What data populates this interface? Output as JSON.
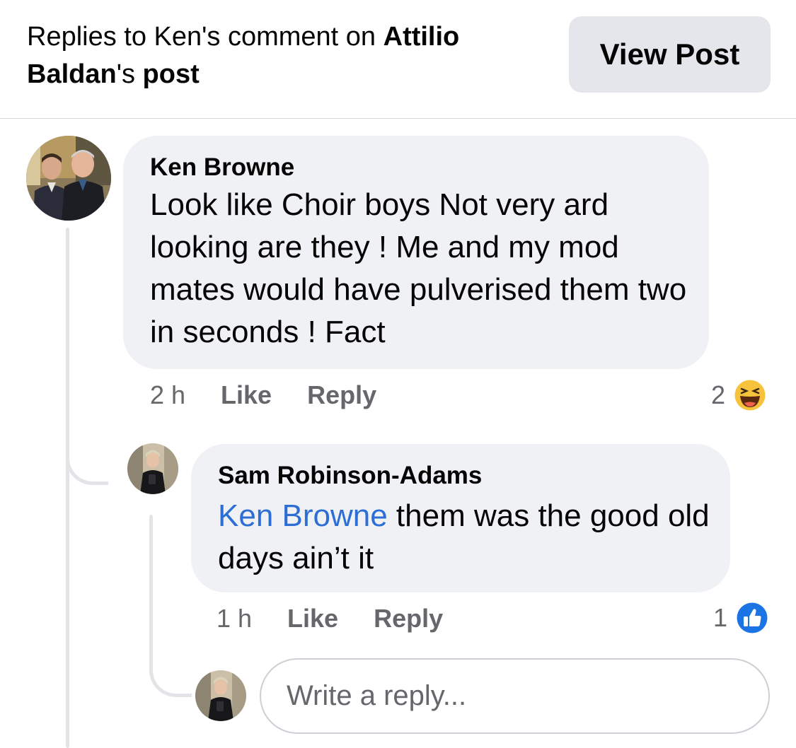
{
  "header": {
    "title_prefix": "Replies to Ken's comment on ",
    "title_name_first": "Attilio",
    "title_name_last": "Baldan",
    "title_suffix_possessive": "'s",
    "title_suffix_word": "post",
    "view_post_label": "View Post"
  },
  "comment": {
    "author": "Ken Browne",
    "text": "Look like   Choir  boys Not very ard looking are they ! Me and my mod mates would have pulverised them two in seconds ! Fact",
    "time": "2 h",
    "like_label": "Like",
    "reply_label": "Reply",
    "reaction_count": "2",
    "reaction_icon": "haha-emoji-icon"
  },
  "reply": {
    "author": "Sam Robinson-Adams",
    "mention": "Ken Browne",
    "text": " them was the good old days ain’t it",
    "time": "1 h",
    "like_label": "Like",
    "reply_label": "Reply",
    "reaction_count": "1",
    "reaction_icon": "like-thumb-icon"
  },
  "composer": {
    "placeholder": "Write a reply..."
  },
  "colors": {
    "bubble_bg": "#f0f1f4",
    "mention": "#2d6ed4",
    "meta_gray": "#65676b",
    "like_blue": "#1b74e4",
    "haha_yellow": "#f7c33c"
  }
}
